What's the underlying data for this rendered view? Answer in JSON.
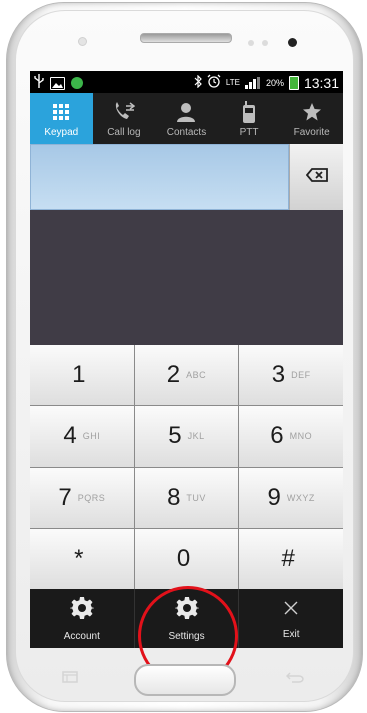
{
  "status_bar": {
    "time": "13:31",
    "battery_percent": "20%",
    "network": "LTE",
    "icons": [
      "usb-icon",
      "image-icon",
      "chat-icon",
      "bluetooth-icon",
      "alarm-icon",
      "lte-icon",
      "signal-icon",
      "battery-icon"
    ]
  },
  "tabs": [
    {
      "label": "Keypad",
      "icon": "keypad-icon",
      "active": true
    },
    {
      "label": "Call log",
      "icon": "call-log-icon",
      "active": false
    },
    {
      "label": "Contacts",
      "icon": "contacts-icon",
      "active": false
    },
    {
      "label": "PTT",
      "icon": "ptt-icon",
      "active": false
    },
    {
      "label": "Favorite",
      "icon": "star-icon",
      "active": false
    }
  ],
  "number_input": {
    "value": ""
  },
  "keypad": [
    {
      "digit": "1",
      "letters": ""
    },
    {
      "digit": "2",
      "letters": "ABC"
    },
    {
      "digit": "3",
      "letters": "DEF"
    },
    {
      "digit": "4",
      "letters": "GHI"
    },
    {
      "digit": "5",
      "letters": "JKL"
    },
    {
      "digit": "6",
      "letters": "MNO"
    },
    {
      "digit": "7",
      "letters": "PQRS"
    },
    {
      "digit": "8",
      "letters": "TUV"
    },
    {
      "digit": "9",
      "letters": "WXYZ"
    },
    {
      "digit": "*",
      "letters": ""
    },
    {
      "digit": "0",
      "letters": ""
    },
    {
      "digit": "#",
      "letters": ""
    }
  ],
  "actions": [
    {
      "label": "Account",
      "icon": "gear-icon"
    },
    {
      "label": "Settings",
      "icon": "gear-icon"
    },
    {
      "label": "Exit",
      "icon": "close-icon"
    }
  ],
  "colors": {
    "active_tab": "#2ba3dc",
    "screen_background": "#403c46",
    "highlight_circle": "#e2111a",
    "battery": "#43b63a"
  }
}
